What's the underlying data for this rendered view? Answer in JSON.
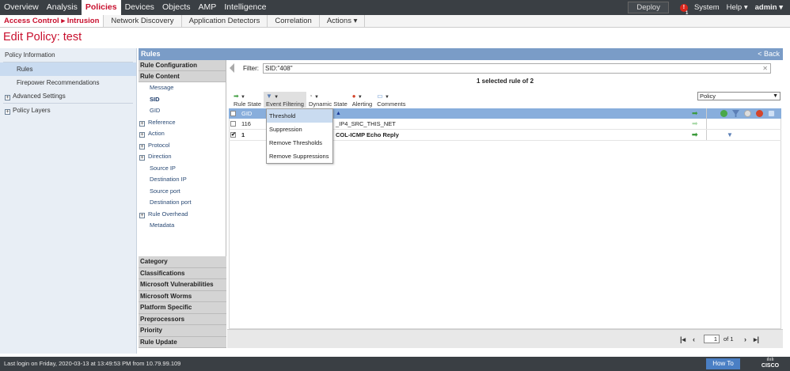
{
  "topnav": {
    "items": [
      "Overview",
      "Analysis",
      "Policies",
      "Devices",
      "Objects",
      "AMP",
      "Intelligence"
    ],
    "active": "Policies",
    "deploy_label": "Deploy",
    "alert_count": "1",
    "system_label": "System",
    "help_label": "Help ▾",
    "user_label": "admin ▾"
  },
  "subnav": {
    "active_label": "Access Control ▸ Intrusion",
    "items": [
      "Network Discovery",
      "Application Detectors",
      "Correlation",
      "Actions ▾"
    ]
  },
  "page_title": "Edit Policy: test",
  "left_panel": {
    "items": [
      {
        "label": "Policy Information"
      },
      {
        "label": "Rules"
      },
      {
        "label": "Firepower Recommendations"
      },
      {
        "label": "Advanced Settings"
      },
      {
        "label": "Policy Layers"
      }
    ]
  },
  "rules": {
    "header": "Rules",
    "back_label": "< Back",
    "filter_sections": {
      "rule_configuration": "Rule Configuration",
      "rule_content": "Rule Content",
      "content_items": [
        "Message",
        "SID",
        "GID",
        "Reference",
        "Action",
        "Protocol",
        "Direction",
        "Source IP",
        "Destination IP",
        "Source port",
        "Destination port",
        "Rule Overhead",
        "Metadata"
      ],
      "bottom_sections": [
        "Category",
        "Classifications",
        "Microsoft Vulnerabilities",
        "Microsoft Worms",
        "Platform Specific",
        "Preprocessors",
        "Priority",
        "Rule Update"
      ]
    },
    "filter_label": "Filter:",
    "filter_value": "SID:\"408\"",
    "selected_text": "1 selected rule of 2",
    "toolbar": [
      "Rule State",
      "Event Filtering",
      "Dynamic State",
      "Alerting",
      "Comments"
    ],
    "policy_select": "Policy",
    "grid": {
      "header_gid": "GID",
      "rows": [
        {
          "gid": "116",
          "message": "_IP4_SRC_THIS_NET",
          "checked": false
        },
        {
          "gid": "1",
          "message": "COL-ICMP Echo Reply",
          "checked": true
        }
      ]
    },
    "dropdown": [
      "Threshold",
      "Suppression",
      "Remove Thresholds",
      "Remove Suppressions"
    ],
    "pager": {
      "page": "1",
      "of_label": "of  1"
    }
  },
  "footer": {
    "last_login": "Last login on Friday, 2020-03-13 at 13:49:53 PM from 10.79.99.109",
    "howto_label": "How To",
    "brand": "CISCO"
  },
  "colors": {
    "accent": "#c8102e",
    "nav_bg": "#3a3f44",
    "grid_header": "#88aedc",
    "rules_header": "#7a9cc7"
  }
}
